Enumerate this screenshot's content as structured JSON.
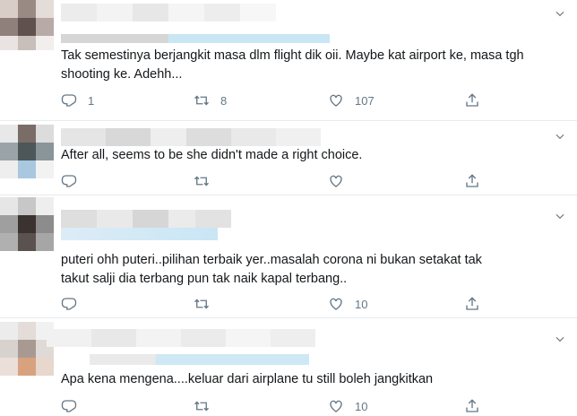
{
  "colors": {
    "icon": "#657786",
    "text": "#14171a",
    "divider": "#e6ecf0",
    "link_tint": "#c9e6f5"
  },
  "tweets": [
    {
      "text": "Tak semestinya berjangkit masa dlm flight dik oii. Maybe kat airport ke, masa tgh shooting ke. Adehh...",
      "reply_count": "1",
      "retweet_count": "8",
      "like_count": "107"
    },
    {
      "text": "After all, seems to be she didn't made a right choice.",
      "reply_count": "",
      "retweet_count": "",
      "like_count": ""
    },
    {
      "text": "puteri ohh puteri..pilihan terbaik yer..masalah corona ni bukan setakat tak takut salji dia terbang pun tak naik kapal terbang..",
      "reply_count": "",
      "retweet_count": "",
      "like_count": "10"
    },
    {
      "text": "Apa kena mengena....keluar dari airplane tu still boleh jangkitkan",
      "reply_count": "",
      "retweet_count": "",
      "like_count": "10"
    }
  ],
  "icons": [
    "reply-icon",
    "retweet-icon",
    "like-icon",
    "share-icon",
    "chevron-down-icon"
  ]
}
